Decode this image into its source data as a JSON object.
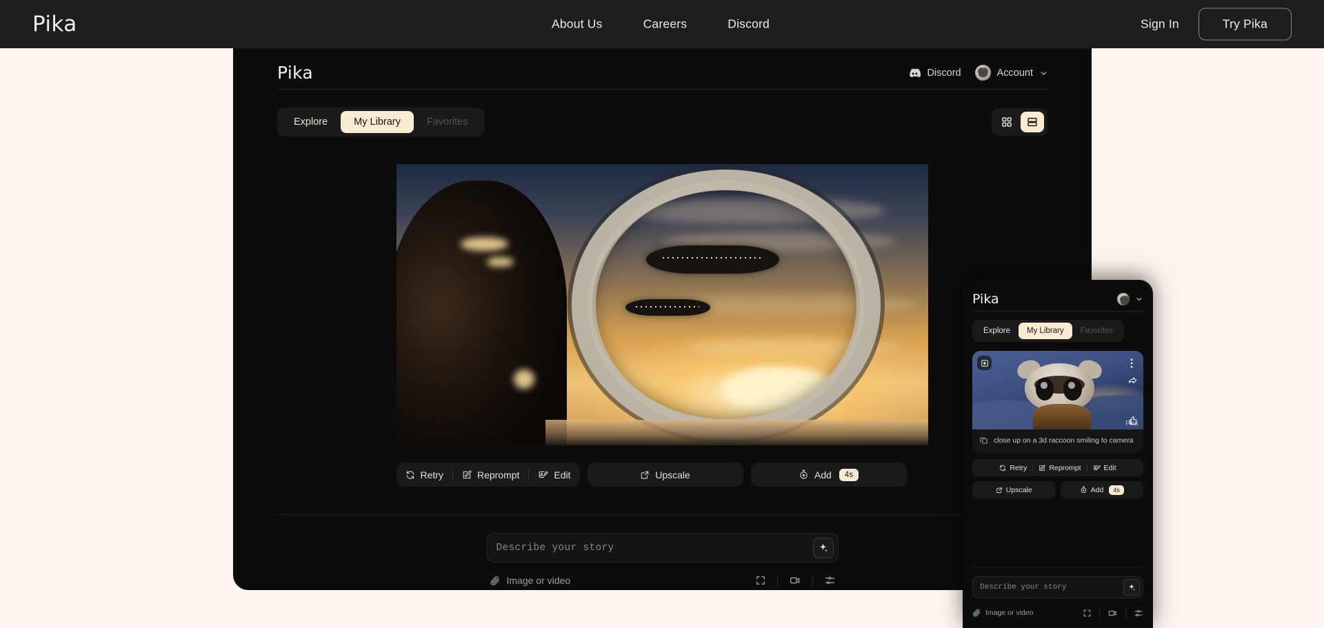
{
  "colors": {
    "page_bg": "#FDF4EE",
    "nav_bg": "#1E1E1E",
    "app_bg": "#0C0C0C",
    "accent_cream": "#FBEBD2",
    "text_light": "#F2EFEA",
    "text_muted": "#56524C"
  },
  "topnav": {
    "logo": "Pika",
    "links": [
      {
        "label": "About Us",
        "name": "nav-link-about-us"
      },
      {
        "label": "Careers",
        "name": "nav-link-careers"
      },
      {
        "label": "Discord",
        "name": "nav-link-discord"
      }
    ],
    "sign_in": "Sign In",
    "try_pika": "Try Pika"
  },
  "app": {
    "logo": "Pika",
    "header": {
      "discord_label": "Discord",
      "account_label": "Account",
      "discord_icon": "discord-icon",
      "avatar_icon": "avatar",
      "chevron_icon": "chevron-down-icon"
    },
    "tabs": [
      {
        "label": "Explore",
        "state": "normal"
      },
      {
        "label": "My Library",
        "state": "active"
      },
      {
        "label": "Favorites",
        "state": "muted"
      }
    ],
    "view_toggle": [
      {
        "name": "grid-view-icon",
        "state": "normal"
      },
      {
        "name": "list-view-icon",
        "state": "active"
      }
    ],
    "video": {
      "alt": "Sci-fi scene: figure silhouetted before a large circular spaceship airlock window looking out at spacecraft flying against a golden sunset sky"
    },
    "actions": {
      "retry": "Retry",
      "reprompt": "Reprompt",
      "edit": "Edit",
      "upscale": "Upscale",
      "add": "Add",
      "add_duration": "4s"
    },
    "prompt": {
      "placeholder": "Describe your story",
      "submit_icon": "sparkle-icon",
      "attach_label": "Image or video",
      "attach_icon": "paperclip-icon",
      "tools": [
        {
          "name": "aspect-ratio-icon"
        },
        {
          "name": "video-camera-icon"
        },
        {
          "name": "settings-sliders-icon"
        }
      ]
    }
  },
  "mobile": {
    "logo": "Pika",
    "header": {
      "avatar_icon": "avatar",
      "chevron_icon": "chevron-down-icon"
    },
    "tabs": [
      {
        "label": "Explore",
        "state": "normal"
      },
      {
        "label": "My Library",
        "state": "active"
      },
      {
        "label": "Favorites",
        "state": "muted"
      }
    ],
    "card": {
      "caption": "close up on a 3d raccoon smiling to camera",
      "caption_icon": "copy-icon",
      "play_icon": "play-box-icon",
      "menu_icon": "kebab-menu-icon",
      "share_icon": "share-arrow-icon",
      "like_icon": "thumbs-up-icon",
      "watermark": "Pika",
      "thumb_alt": "3D animated raccoon smiling at camera against blue mountain night sky"
    },
    "actions": {
      "retry": "Retry",
      "reprompt": "Reprompt",
      "edit": "Edit",
      "upscale": "Upscale",
      "add": "Add",
      "add_duration": "4s"
    },
    "prompt": {
      "placeholder": "Describe your story",
      "submit_icon": "sparkle-icon",
      "attach_label": "Image or video",
      "attach_icon": "paperclip-icon",
      "tools": [
        {
          "name": "aspect-ratio-icon"
        },
        {
          "name": "video-camera-icon"
        },
        {
          "name": "settings-sliders-icon"
        }
      ]
    }
  }
}
